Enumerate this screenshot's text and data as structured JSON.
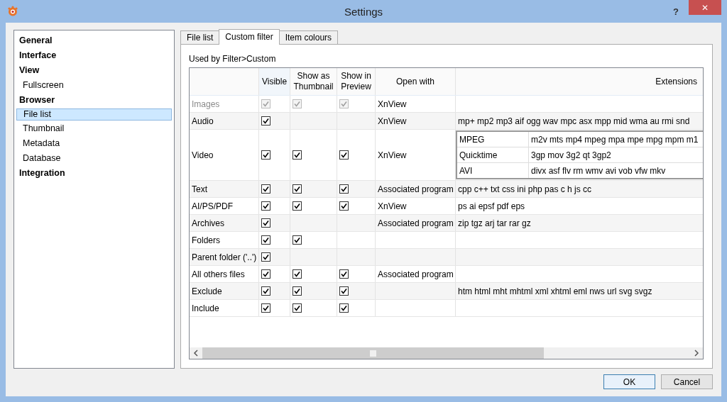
{
  "window": {
    "title": "Settings",
    "help": "?",
    "close": "✕"
  },
  "sidebar": {
    "items": [
      {
        "label": "General",
        "selected": false
      },
      {
        "label": "Interface",
        "selected": false
      },
      {
        "label": "View",
        "selected": false,
        "children": [
          {
            "label": "Fullscreen",
            "selected": false
          }
        ]
      },
      {
        "label": "Browser",
        "selected": false,
        "children": [
          {
            "label": "File list",
            "selected": true
          },
          {
            "label": "Thumbnail",
            "selected": false
          },
          {
            "label": "Metadata",
            "selected": false
          },
          {
            "label": "Database",
            "selected": false
          }
        ]
      },
      {
        "label": "Integration",
        "selected": false
      }
    ]
  },
  "tabs": [
    {
      "label": "File list",
      "selected": false
    },
    {
      "label": "Custom filter",
      "selected": true
    },
    {
      "label": "Item colours",
      "selected": false
    }
  ],
  "caption": "Used by Filter>Custom",
  "table": {
    "columns": [
      "Visible",
      "Show as Thumbnail",
      "Show in Preview",
      "Open with",
      "Extensions"
    ],
    "rows": [
      {
        "name": "Images",
        "disabled": true,
        "visible": true,
        "thumbnail": true,
        "preview": true,
        "open_with": "XnView",
        "kind": "plain"
      },
      {
        "name": "Audio",
        "disabled": false,
        "visible": true,
        "open_with": "XnView",
        "kind": "plain",
        "extensions": "mp+ mp2 mp3 aif ogg wav mpc asx mpp mid wma au rmi snd"
      },
      {
        "name": "Video",
        "disabled": false,
        "visible": true,
        "thumbnail": true,
        "preview": true,
        "open_with": "XnView",
        "kind": "nested",
        "groups": [
          {
            "name": "MPEG",
            "extensions": "m2v mts mp4 mpeg mpa mpe mpg mpm m1"
          },
          {
            "name": "Quicktime",
            "extensions": "3gp mov 3g2 qt 3gp2"
          },
          {
            "name": "AVI",
            "extensions": "divx asf flv rm wmv avi vob vfw mkv"
          }
        ]
      },
      {
        "name": "Text",
        "disabled": false,
        "visible": true,
        "thumbnail": true,
        "preview": true,
        "open_with": "Associated program",
        "kind": "plain",
        "extensions": "cpp c++ txt css ini php pas c h js cc"
      },
      {
        "name": "AI/PS/PDF",
        "disabled": false,
        "visible": true,
        "thumbnail": true,
        "preview": true,
        "open_with": "XnView",
        "kind": "plain",
        "extensions": "ps ai epsf pdf eps"
      },
      {
        "name": "Archives",
        "disabled": false,
        "visible": true,
        "open_with": "Associated program",
        "kind": "plain",
        "extensions": "zip tgz arj tar rar gz"
      },
      {
        "name": "Folders",
        "disabled": false,
        "visible": true,
        "thumbnail": true,
        "kind": "plain"
      },
      {
        "name": "Parent folder ('..')",
        "disabled": false,
        "visible": true,
        "kind": "plain"
      },
      {
        "name": "All others files",
        "disabled": false,
        "visible": true,
        "thumbnail": true,
        "preview": true,
        "open_with": "Associated program",
        "kind": "plain"
      },
      {
        "name": "Exclude",
        "disabled": false,
        "visible": true,
        "thumbnail": true,
        "preview": true,
        "kind": "plain",
        "extensions": "htm html mht mhtml xml xhtml eml nws url svg svgz"
      },
      {
        "name": "Include",
        "disabled": false,
        "visible": true,
        "thumbnail": true,
        "preview": true,
        "kind": "plain"
      }
    ]
  },
  "buttons": [
    {
      "label": "OK",
      "default": true
    },
    {
      "label": "Cancel",
      "default": false
    }
  ]
}
